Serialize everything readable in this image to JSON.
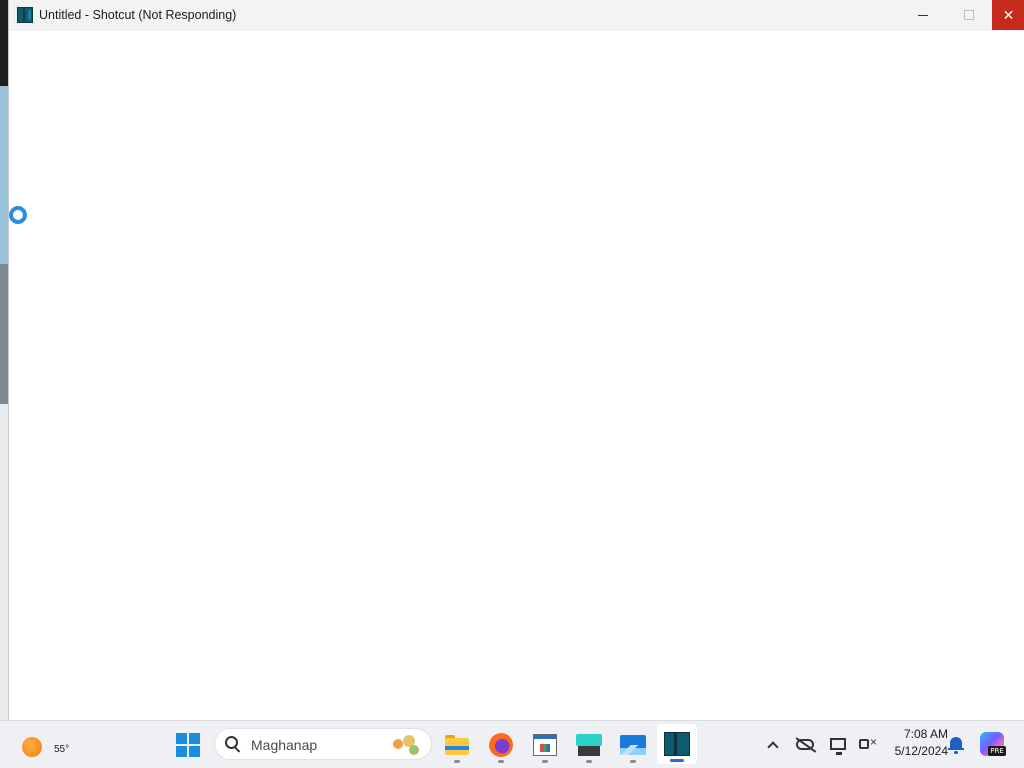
{
  "window": {
    "title": "Untitled - Shotcut (Not Responding)",
    "buttons": {
      "minimize": "minimize",
      "maximize": "maximize",
      "close": "✕"
    }
  },
  "cursor": {
    "state": "busy"
  },
  "taskbar": {
    "weather": {
      "temp": "55°",
      "icon": "sun-icon"
    },
    "search": {
      "placeholder": "Maghanap"
    },
    "apps": [
      {
        "name": "File Explorer",
        "icon": "folder-icon",
        "running": true
      },
      {
        "name": "Firefox",
        "icon": "firefox-icon",
        "running": true
      },
      {
        "name": "App",
        "icon": "app-window-icon",
        "running": true
      },
      {
        "name": "Keyboard App",
        "icon": "keyboard-icon",
        "running": true
      },
      {
        "name": "Photos",
        "icon": "photos-icon",
        "running": true
      },
      {
        "name": "Shotcut",
        "icon": "shotcut-icon",
        "running": true,
        "active": true
      }
    ],
    "tray": {
      "time": "7:08 AM",
      "date": "5/12/2024",
      "badge": "PRE"
    }
  },
  "colors": {
    "close_button": "#c42b1c",
    "accent": "#1f6fd6",
    "busy_cursor": "#2b8ee0"
  }
}
